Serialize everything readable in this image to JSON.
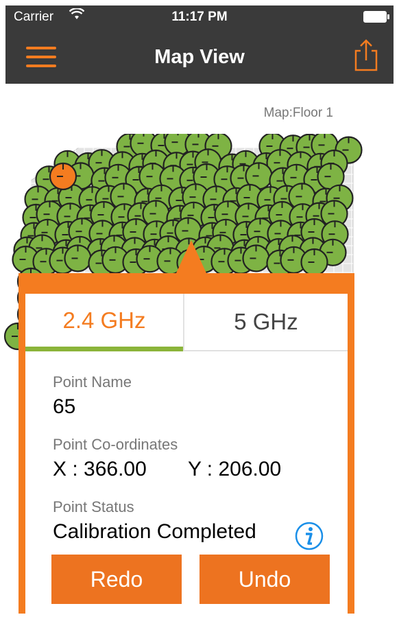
{
  "status_bar": {
    "carrier": "Carrier",
    "time": "11:17 PM"
  },
  "nav": {
    "title": "Map View"
  },
  "map": {
    "label": "Map:Floor 1"
  },
  "popup": {
    "tabs": [
      {
        "label": "2.4 GHz",
        "selected": true
      },
      {
        "label": "5 GHz",
        "selected": false
      }
    ],
    "point_name_label": "Point Name",
    "point_name": "65",
    "coords_label": "Point Co-ordinates",
    "x_value": "X : 366.00",
    "y_value": "Y : 206.00",
    "status_label": "Point Status",
    "status_value": "Calibration Completed",
    "redo_label": "Redo",
    "undo_label": "Undo"
  },
  "colors": {
    "accent": "#f47c20",
    "navbar": "#3a3a3a",
    "point_green": "#7eb344",
    "selected_tab_underline": "#8bb43a",
    "info_blue": "#1a8fe8"
  }
}
